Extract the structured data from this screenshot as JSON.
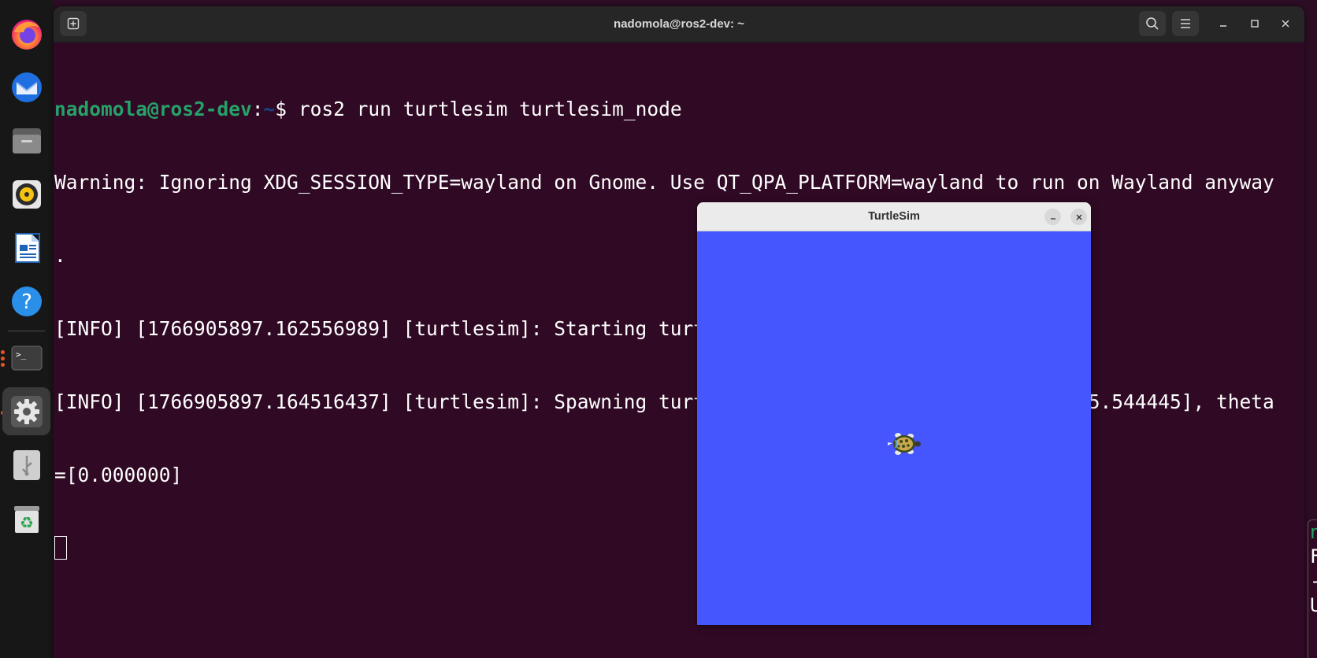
{
  "dock": {
    "items": [
      {
        "icon": "firefox-icon"
      },
      {
        "icon": "thunderbird-icon"
      },
      {
        "icon": "files-icon"
      },
      {
        "icon": "rhythmbox-icon"
      },
      {
        "icon": "libreoffice-writer-icon"
      },
      {
        "icon": "help-icon",
        "glyph": "?"
      },
      {
        "icon": "terminal-icon",
        "glyph": ">_"
      },
      {
        "icon": "settings-icon"
      },
      {
        "icon": "usb-drive-icon"
      },
      {
        "icon": "trash-icon",
        "glyph": "♻"
      }
    ],
    "accent_color": "#e95420"
  },
  "terminal": {
    "title": "nadomola@ros2-dev: ~",
    "prompt": {
      "user_host": "nadomola@ros2-dev",
      "separator": ":",
      "path": "~",
      "symbol": "$ ",
      "command": "ros2 run turtlesim turtlesim_node"
    },
    "output": [
      "Warning: Ignoring XDG_SESSION_TYPE=wayland on Gnome. Use QT_QPA_PLATFORM=wayland to run on Wayland anyway",
      ".",
      "[INFO] [1766905897.162556989] [turtlesim]: Starting turtlesim with node name /turtlesim",
      "[INFO] [1766905897.164516437] [turtlesim]: Spawning turtle [turtle1] at x=[5.544445], y=[5.544445], theta",
      "=[0.000000]"
    ],
    "colors": {
      "background": "#300a24",
      "prompt_user": "#26a269",
      "prompt_path": "#12488b"
    }
  },
  "turtlesim": {
    "title": "TurtleSim",
    "background_color": "#4556ff",
    "turtle": {
      "name": "turtle1",
      "x": 5.544445,
      "y": 5.544445,
      "theta": 0.0
    }
  },
  "edge_window": {
    "lines": [
      "n",
      "F",
      "-",
      "U"
    ]
  }
}
